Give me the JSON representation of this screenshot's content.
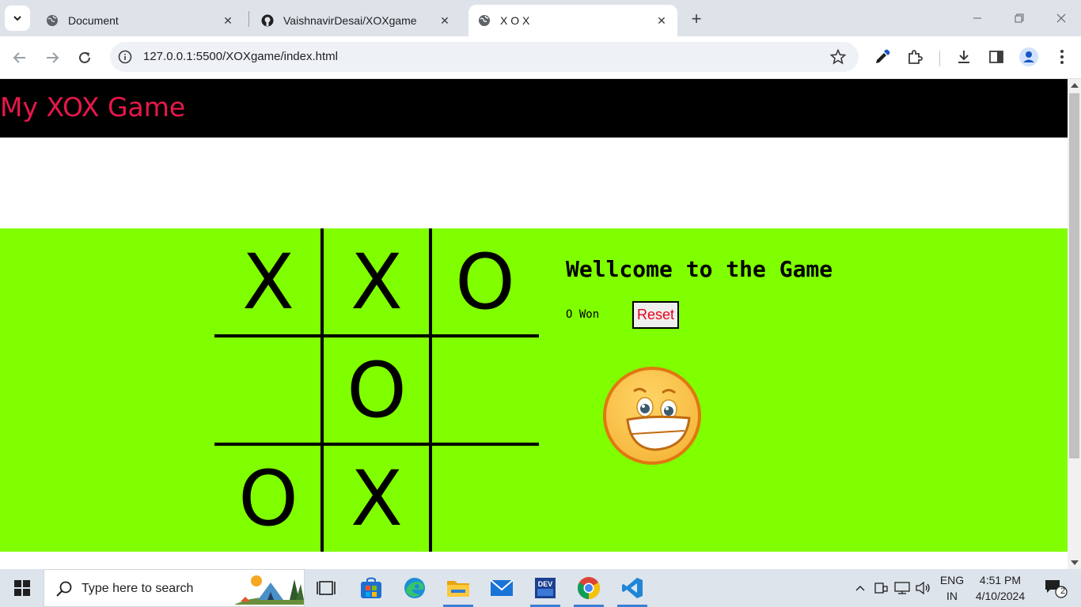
{
  "browser": {
    "tabs": [
      {
        "title": "Document",
        "favicon": "globe-icon",
        "active": false
      },
      {
        "title": "VaishnavirDesai/XOXgame",
        "favicon": "github-icon",
        "active": false
      },
      {
        "title": "X O X",
        "favicon": "globe-icon",
        "active": true
      }
    ],
    "url": "127.0.0.1:5500/XOXgame/index.html"
  },
  "page": {
    "site_title": "My XOX Game",
    "board": [
      "X",
      "X",
      "O",
      "",
      "O",
      "",
      "O",
      "X",
      ""
    ],
    "welcome": "Wellcome to the Game",
    "status": "O Won",
    "reset_label": "Reset",
    "winner_image": "grinning-emoji"
  },
  "taskbar": {
    "search_placeholder": "Type here to search",
    "lang_line1": "ENG",
    "lang_line2": "IN",
    "time": "4:51 PM",
    "date": "4/10/2024",
    "notification_count": "2",
    "apps": [
      "task-view-icon",
      "microsoft-store-icon",
      "edge-icon",
      "file-explorer-icon",
      "mail-icon",
      "dev-cpp-icon",
      "chrome-icon",
      "vscode-icon"
    ]
  },
  "colors": {
    "header_bg": "#000000",
    "title_color": "#e8174a",
    "game_bg": "#80ff00",
    "reset_text": "#e8001c"
  }
}
